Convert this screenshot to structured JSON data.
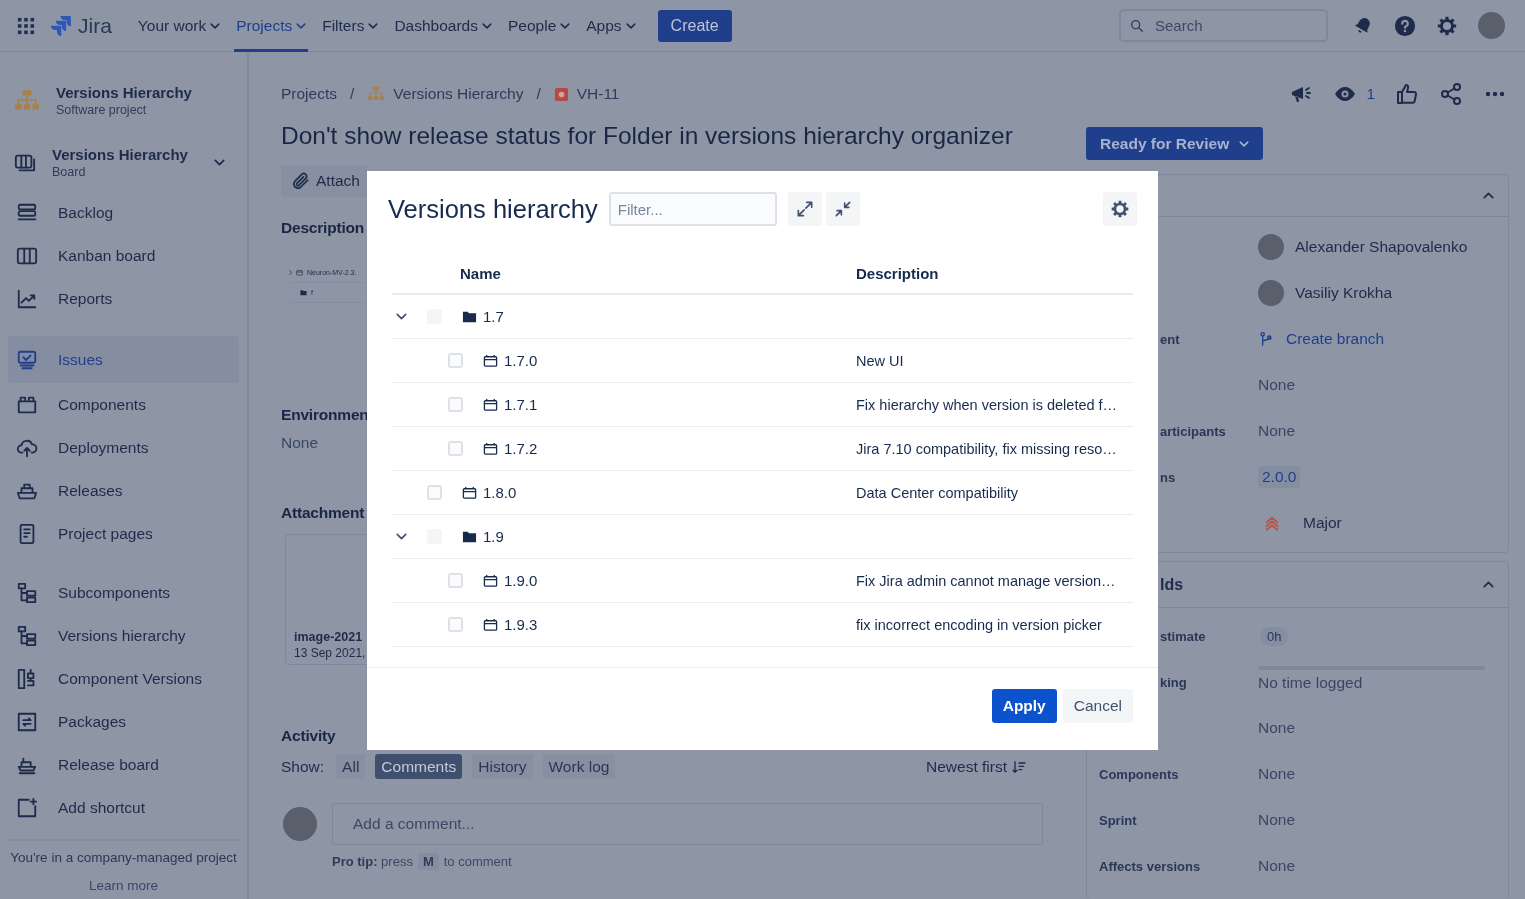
{
  "top_nav": {
    "product": "Jira",
    "items": [
      {
        "label": "Your work",
        "selected": false
      },
      {
        "label": "Projects",
        "selected": true
      },
      {
        "label": "Filters",
        "selected": false
      },
      {
        "label": "Dashboards",
        "selected": false
      },
      {
        "label": "People",
        "selected": false
      },
      {
        "label": "Apps",
        "selected": false
      }
    ],
    "create": "Create",
    "search": {
      "placeholder": "Search"
    }
  },
  "sidebar": {
    "project": {
      "name": "Versions Hierarchy",
      "type": "Software project"
    },
    "board": {
      "name": "Versions Hierarchy",
      "type": "Board"
    },
    "sections": [
      [
        {
          "label": "Backlog",
          "selected": false
        },
        {
          "label": "Kanban board",
          "selected": false
        },
        {
          "label": "Reports",
          "selected": false
        }
      ],
      [
        {
          "label": "Issues",
          "selected": true
        },
        {
          "label": "Components",
          "selected": false
        },
        {
          "label": "Deployments",
          "selected": false
        },
        {
          "label": "Releases",
          "selected": false
        },
        {
          "label": "Project pages",
          "selected": false
        }
      ],
      [
        {
          "label": "Subcomponents",
          "selected": false
        },
        {
          "label": "Versions hierarchy",
          "selected": false
        },
        {
          "label": "Component Versions",
          "selected": false
        },
        {
          "label": "Packages",
          "selected": false
        },
        {
          "label": "Release board",
          "selected": false
        },
        {
          "label": "Add shortcut",
          "selected": false
        }
      ]
    ],
    "footer": {
      "text": "You're in a company-managed project",
      "link": "Learn more"
    }
  },
  "issue": {
    "breadcrumbs": [
      "Projects",
      "Versions Hierarchy",
      "VH-11"
    ],
    "breadcrumb_separator": "/",
    "title": "Don't show release status for Folder in versions hierarchy organizer",
    "watchers": "1",
    "status": "Ready for Review",
    "attach": "Attach",
    "description": {
      "heading": "Description",
      "embedded": [
        "Neuron-MV-2.3.",
        "f"
      ]
    },
    "environment": {
      "heading": "Environmen",
      "value": "None"
    },
    "attachments": {
      "heading": "Attachment",
      "file": {
        "name": "image-2021",
        "date": "13 Sep 2021,"
      }
    },
    "activity": {
      "heading": "Activity",
      "show_label": "Show:",
      "filters": [
        {
          "label": "All",
          "selected": false
        },
        {
          "label": "Comments",
          "selected": true
        },
        {
          "label": "History",
          "selected": false
        },
        {
          "label": "Work log",
          "selected": false
        }
      ],
      "sort": "Newest first",
      "comment": {
        "placeholder": "Add a comment..."
      },
      "tip": {
        "text": "**Pro tip:** press",
        "key": "M",
        "after": "to comment"
      }
    }
  },
  "details": [
    {
      "rows": [
        {
          "kind": "person",
          "value": "Alexander Shapovalenko"
        },
        {
          "kind": "person",
          "value": "Vasiliy Krokha"
        },
        {
          "kind": "link",
          "label": "ent",
          "partly_hidden": true,
          "value": "Create branch"
        },
        {
          "kind": "text",
          "value": "None"
        },
        {
          "kind": "text",
          "label": "articipants",
          "partly_hidden": true,
          "value": "None"
        },
        {
          "kind": "tag",
          "label": "ns",
          "partly_hidden": true,
          "value": "2.0.0"
        },
        {
          "kind": "priority",
          "value": "Major"
        }
      ]
    },
    {
      "title": "lds",
      "rows": [
        {
          "kind": "estimate",
          "label": "stimate",
          "partly_hidden": true,
          "value": "0h"
        },
        {
          "kind": "tracking",
          "label": "king",
          "partly_hidden": true,
          "value": "No time logged",
          "level": 0
        },
        {
          "kind": "text",
          "value": "None"
        },
        {
          "kind": "text",
          "label": "Components",
          "value": "None"
        },
        {
          "kind": "text",
          "label": "Sprint",
          "value": "None"
        },
        {
          "kind": "text",
          "label": "Affects versions",
          "value": "None"
        }
      ]
    }
  ],
  "modal": {
    "title": "Versions hierarchy",
    "filter": {
      "placeholder": "Filter..."
    },
    "columns": [
      "Name",
      "Description"
    ],
    "rows": [
      {
        "kind": "folder",
        "name": "1.7",
        "expanded": true,
        "checked": false,
        "children": [
          {
            "kind": "version",
            "name": "1.7.0",
            "description": "New UI",
            "checked": false
          },
          {
            "kind": "version",
            "name": "1.7.1",
            "description": "Fix hierarchy when version is deleted f…",
            "checked": false
          },
          {
            "kind": "version",
            "name": "1.7.2",
            "description": "Jira 7.10 compatibility, fix missing reso…",
            "checked": false
          }
        ]
      },
      {
        "kind": "version",
        "name": "1.8.0",
        "description": "Data Center compatibility",
        "checked": false
      },
      {
        "kind": "folder",
        "name": "1.9",
        "expanded": true,
        "checked": false,
        "children": [
          {
            "kind": "version",
            "name": "1.9.0",
            "description": "Fix Jira admin cannot manage version…",
            "checked": false
          },
          {
            "kind": "version",
            "name": "1.9.3",
            "description": "fix incorrect encoding in version picker",
            "checked": false
          }
        ]
      }
    ],
    "buttons": [
      "Apply",
      "Cancel"
    ]
  }
}
